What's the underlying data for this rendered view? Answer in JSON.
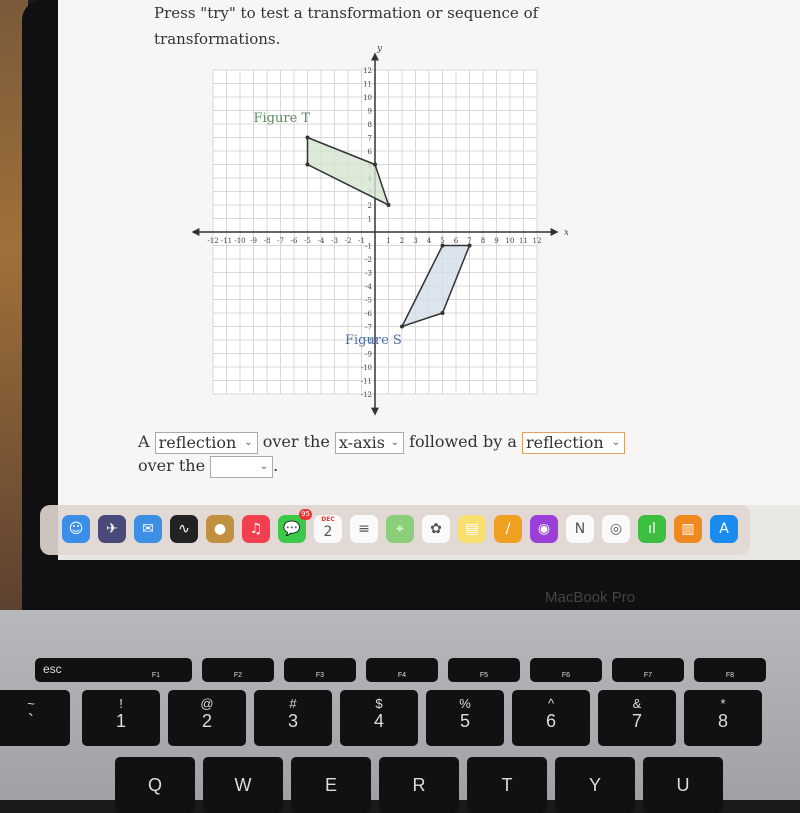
{
  "instructions": {
    "line1": "Press \"try\" to test a transformation or sequence of",
    "line2": "transformations."
  },
  "graph": {
    "x_label": "x",
    "y_label": "y",
    "x_range": [
      -12,
      12
    ],
    "y_range": [
      -12,
      12
    ],
    "grid": true,
    "figures": [
      {
        "label": "Figure T",
        "color": "#5a8a5a",
        "fill": "#d5e3d0",
        "vertices": [
          [
            -5,
            7
          ],
          [
            0,
            5
          ],
          [
            1,
            2
          ],
          [
            -5,
            5
          ]
        ]
      },
      {
        "label": "Figure S",
        "color": "#4a6fa5",
        "fill": "#d3dde9",
        "vertices": [
          [
            5,
            -1
          ],
          [
            7,
            -1
          ],
          [
            5,
            -6
          ],
          [
            2,
            -7
          ]
        ]
      }
    ]
  },
  "answer": {
    "prefix": "A",
    "select1": "reflection",
    "mid1": "over the",
    "select2": "x-axis",
    "mid2": "followed by a",
    "select3": "reflection",
    "line2_prefix": "over the",
    "select4": "",
    "end": "."
  },
  "dock": {
    "apps": [
      {
        "name": "finder",
        "color": "#3b8ee8",
        "glyph": "☺"
      },
      {
        "name": "launchpad",
        "color": "#4a4a7a",
        "glyph": "✈"
      },
      {
        "name": "mail",
        "color": "#3d8fe6",
        "glyph": "✉"
      },
      {
        "name": "activity-monitor",
        "color": "#222",
        "glyph": "∿"
      },
      {
        "name": "contacts",
        "color": "#c09040",
        "glyph": "●"
      },
      {
        "name": "music",
        "color": "#f04050",
        "glyph": "♫"
      },
      {
        "name": "messages",
        "color": "#3cc84a",
        "glyph": "💬",
        "badge": "95"
      },
      {
        "name": "calendar",
        "color": "#fafafa",
        "glyph": "2",
        "month": "DEC"
      },
      {
        "name": "reminders",
        "color": "#fafafa",
        "glyph": "≡"
      },
      {
        "name": "maps",
        "color": "#8ccf7a",
        "glyph": "⌖"
      },
      {
        "name": "photos",
        "color": "#fafafa",
        "glyph": "✿"
      },
      {
        "name": "notes",
        "color": "#f8e070",
        "glyph": "▤"
      },
      {
        "name": "pages",
        "color": "#f0a020",
        "glyph": "/"
      },
      {
        "name": "podcasts",
        "color": "#9a3fd8",
        "glyph": "◉"
      },
      {
        "name": "news",
        "color": "#fafafa",
        "glyph": "N"
      },
      {
        "name": "chrome",
        "color": "#fafafa",
        "glyph": "◎"
      },
      {
        "name": "numbers",
        "color": "#3cbf40",
        "glyph": "ıl"
      },
      {
        "name": "books",
        "color": "#f08a20",
        "glyph": "▥"
      },
      {
        "name": "app-store",
        "color": "#1a8cf0",
        "glyph": "A"
      }
    ]
  },
  "laptop_label": "MacBook Pro",
  "keyboard": {
    "fn_row": [
      "esc",
      "F1",
      "F2",
      "F3",
      "F4",
      "F5",
      "F6",
      "F7",
      "F8"
    ],
    "num_row": [
      [
        "~",
        "`"
      ],
      [
        "!",
        "1"
      ],
      [
        "@",
        "2"
      ],
      [
        "#",
        "3"
      ],
      [
        "$",
        "4"
      ],
      [
        "%",
        "5"
      ],
      [
        "^",
        "6"
      ],
      [
        "&",
        "7"
      ],
      [
        "*",
        "8"
      ]
    ],
    "letter_row": [
      "Q",
      "W",
      "E",
      "R",
      "T",
      "Y",
      "U"
    ]
  }
}
